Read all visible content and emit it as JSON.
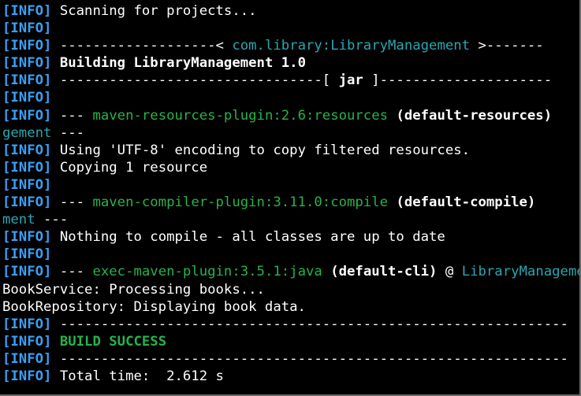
{
  "terminal": {
    "info_tag": "[INFO]",
    "lines": [
      {
        "segments": [
          {
            "text": "[INFO]",
            "cls": "tag"
          },
          {
            "text": " Scanning for projects...",
            "cls": "w"
          }
        ]
      },
      {
        "segments": [
          {
            "text": "[INFO]",
            "cls": "tag"
          }
        ]
      },
      {
        "segments": [
          {
            "text": "[INFO]",
            "cls": "tag"
          },
          {
            "text": " -------------------< ",
            "cls": "w"
          },
          {
            "text": "com.library:LibraryManagement",
            "cls": "c"
          },
          {
            "text": " >-------",
            "cls": "w"
          }
        ]
      },
      {
        "segments": [
          {
            "text": "[INFO]",
            "cls": "tag"
          },
          {
            "text": " Building LibraryManagement 1.0",
            "cls": "b"
          }
        ]
      },
      {
        "segments": [
          {
            "text": "[INFO]",
            "cls": "tag"
          },
          {
            "text": " --------------------------------[ ",
            "cls": "w"
          },
          {
            "text": "jar",
            "cls": "b"
          },
          {
            "text": " ]---------------------",
            "cls": "w"
          }
        ]
      },
      {
        "segments": [
          {
            "text": "[INFO]",
            "cls": "tag"
          }
        ]
      },
      {
        "segments": [
          {
            "text": "[INFO]",
            "cls": "tag"
          },
          {
            "text": " --- ",
            "cls": "w"
          },
          {
            "text": "maven-resources-plugin:2.6:resources",
            "cls": "g"
          },
          {
            "text": " ",
            "cls": "w"
          },
          {
            "text": "(default-resources)",
            "cls": "b"
          }
        ]
      },
      {
        "segments": [
          {
            "text": "gement",
            "cls": "c"
          },
          {
            "text": " ---",
            "cls": "w"
          }
        ]
      },
      {
        "segments": [
          {
            "text": "[INFO]",
            "cls": "tag"
          },
          {
            "text": " Using 'UTF-8' encoding to copy filtered resources.",
            "cls": "w"
          }
        ]
      },
      {
        "segments": [
          {
            "text": "[INFO]",
            "cls": "tag"
          },
          {
            "text": " Copying 1 resource",
            "cls": "w"
          }
        ]
      },
      {
        "segments": [
          {
            "text": "[INFO]",
            "cls": "tag"
          }
        ]
      },
      {
        "segments": [
          {
            "text": "[INFO]",
            "cls": "tag"
          },
          {
            "text": " --- ",
            "cls": "w"
          },
          {
            "text": "maven-compiler-plugin:3.11.0:compile",
            "cls": "g"
          },
          {
            "text": " ",
            "cls": "w"
          },
          {
            "text": "(default-compile)",
            "cls": "b"
          }
        ]
      },
      {
        "segments": [
          {
            "text": "ment",
            "cls": "c"
          },
          {
            "text": " ---",
            "cls": "w"
          }
        ]
      },
      {
        "segments": [
          {
            "text": "[INFO]",
            "cls": "tag"
          },
          {
            "text": " Nothing to compile - all classes are up to date",
            "cls": "w"
          }
        ]
      },
      {
        "segments": [
          {
            "text": "[INFO]",
            "cls": "tag"
          }
        ]
      },
      {
        "segments": [
          {
            "text": "[INFO]",
            "cls": "tag"
          },
          {
            "text": " --- ",
            "cls": "w"
          },
          {
            "text": "exec-maven-plugin:3.5.1:java",
            "cls": "g"
          },
          {
            "text": " ",
            "cls": "w"
          },
          {
            "text": "(default-cli)",
            "cls": "b"
          },
          {
            "text": " @ ",
            "cls": "w"
          },
          {
            "text": "LibraryManagement",
            "cls": "c"
          }
        ]
      },
      {
        "segments": [
          {
            "text": "BookService: Processing books...",
            "cls": "w"
          }
        ]
      },
      {
        "segments": [
          {
            "text": "BookRepository: Displaying book data.",
            "cls": "w"
          }
        ]
      },
      {
        "segments": [
          {
            "text": "[INFO]",
            "cls": "tag"
          },
          {
            "text": " --------------------------------------------------------------",
            "cls": "w"
          }
        ]
      },
      {
        "segments": [
          {
            "text": "[INFO]",
            "cls": "tag"
          },
          {
            "text": " ",
            "cls": "w"
          },
          {
            "text": "BUILD SUCCESS",
            "cls": "gb"
          }
        ]
      },
      {
        "segments": [
          {
            "text": "[INFO]",
            "cls": "tag"
          },
          {
            "text": " --------------------------------------------------------------",
            "cls": "w"
          }
        ]
      },
      {
        "segments": [
          {
            "text": "[INFO]",
            "cls": "tag"
          },
          {
            "text": " Total time:  2.612 s",
            "cls": "w"
          }
        ]
      }
    ]
  }
}
